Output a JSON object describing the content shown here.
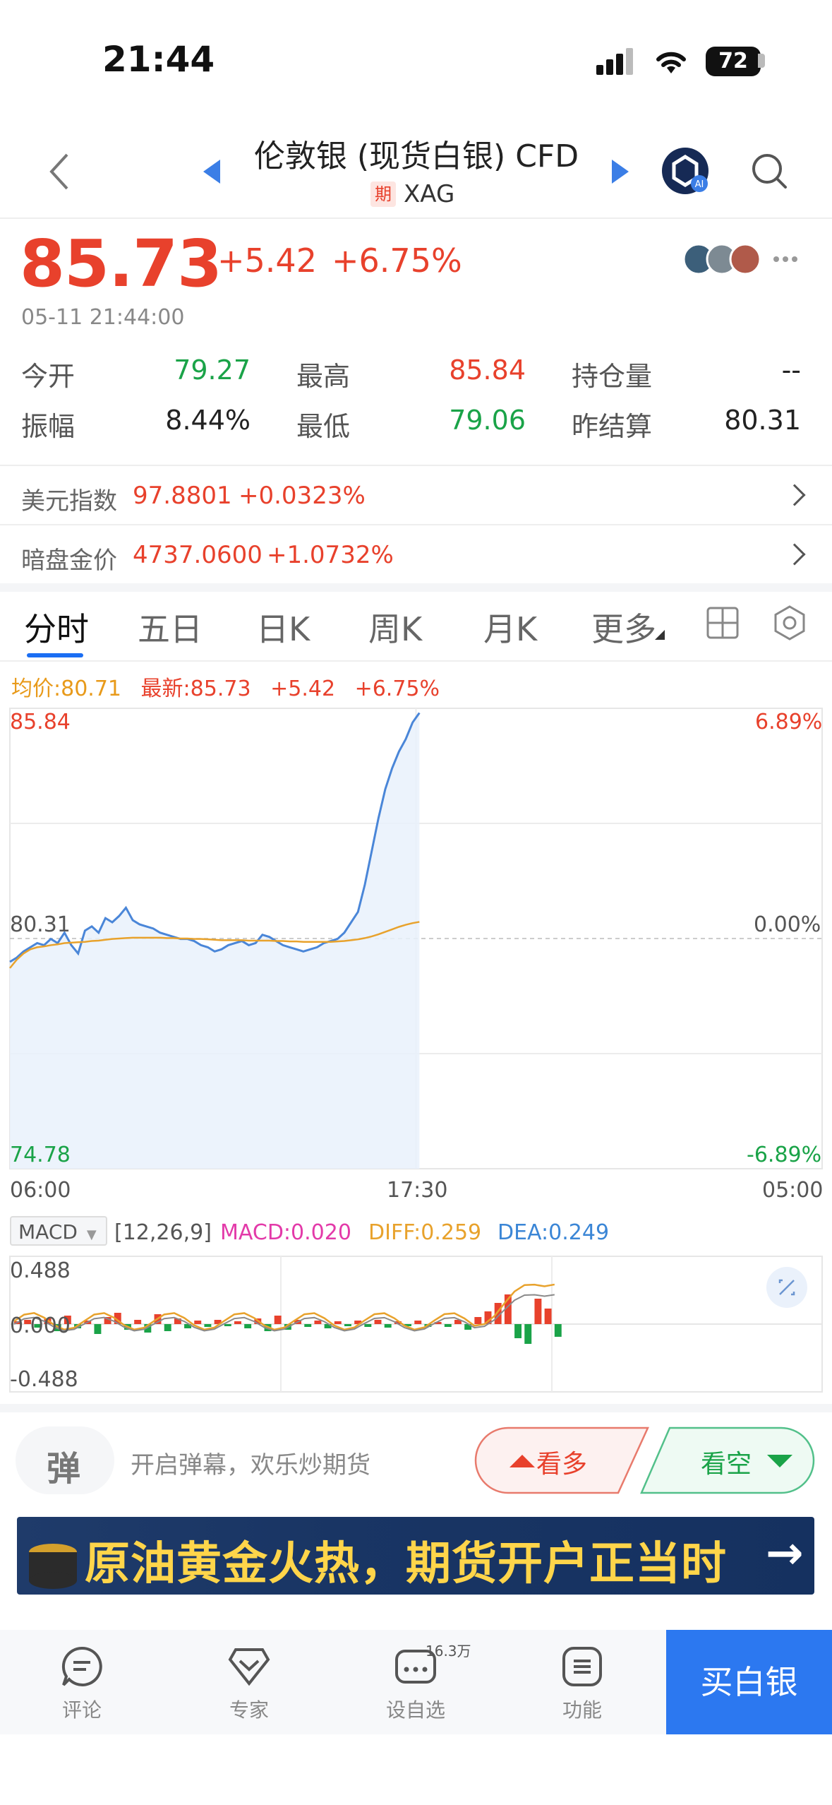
{
  "status_bar": {
    "time": "21:44",
    "battery": "72"
  },
  "nav": {
    "title": "伦敦银 (现货白银) CFD",
    "badge": "期",
    "code": "XAG"
  },
  "quote": {
    "price": "85.73",
    "change": "+5.42",
    "change_pct": "+6.75%",
    "timestamp": "05-11 21:44:00"
  },
  "stats": {
    "open_label": "今开",
    "open_value": "79.27",
    "high_label": "最高",
    "high_value": "85.84",
    "oi_label": "持仓量",
    "oi_value": "--",
    "amp_label": "振幅",
    "amp_value": "8.44%",
    "low_label": "最低",
    "low_value": "79.06",
    "settle_label": "昨结算",
    "settle_value": "80.31"
  },
  "related": [
    {
      "label": "美元指数",
      "value": "97.8801",
      "change": "+0.0323%"
    },
    {
      "label": "暗盘金价",
      "value": "4737.0600",
      "change": "+1.0732%"
    }
  ],
  "tabs": [
    "分时",
    "五日",
    "日K",
    "周K",
    "月K",
    "更多"
  ],
  "chart_header": {
    "avg": "均价:80.71",
    "latest": "最新:85.73",
    "change": "+5.42",
    "pct": "+6.75%"
  },
  "chart_data": {
    "type": "line",
    "left_axis": [
      "85.84",
      "80.31",
      "74.78"
    ],
    "right_axis": [
      "6.89%",
      "0.00%",
      "-6.89%"
    ],
    "x_ticks": [
      "06:00",
      "17:30",
      "05:00"
    ],
    "ylim": [
      74.78,
      85.84
    ],
    "reference": 80.31,
    "series": [
      {
        "name": "",
        "color": "#4a86d8",
        "values": [
          79.75,
          79.85,
          80.0,
          80.1,
          80.2,
          80.15,
          80.3,
          80.2,
          80.45,
          80.15,
          79.95,
          80.5,
          80.6,
          80.45,
          80.8,
          80.7,
          80.85,
          81.05,
          80.75,
          80.65,
          80.6,
          80.55,
          80.45,
          80.4,
          80.35,
          80.3,
          80.3,
          80.25,
          80.15,
          80.1,
          80.0,
          80.05,
          80.15,
          80.2,
          80.25,
          80.15,
          80.2,
          80.4,
          80.35,
          80.25,
          80.15,
          80.1,
          80.05,
          80.0,
          80.05,
          80.1,
          80.2,
          80.25,
          80.3,
          80.45,
          80.7,
          80.95,
          81.6,
          82.4,
          83.2,
          83.9,
          84.4,
          84.8,
          85.1,
          85.5,
          85.73
        ]
      },
      {
        "name": "",
        "color": "#e8a22c",
        "values": [
          79.6,
          79.8,
          79.95,
          80.05,
          80.1,
          80.12,
          80.15,
          80.17,
          80.2,
          80.21,
          80.22,
          80.23,
          80.25,
          80.26,
          80.28,
          80.3,
          80.31,
          80.32,
          80.33,
          80.33,
          80.33,
          80.33,
          80.33,
          80.32,
          80.32,
          80.31,
          80.31,
          80.3,
          80.3,
          80.29,
          80.28,
          80.27,
          80.27,
          80.27,
          80.27,
          80.26,
          80.26,
          80.26,
          80.26,
          80.25,
          80.25,
          80.24,
          80.24,
          80.23,
          80.23,
          80.23,
          80.23,
          80.23,
          80.24,
          80.25,
          80.27,
          80.29,
          80.32,
          80.36,
          80.41,
          80.47,
          80.53,
          80.59,
          80.64,
          80.68,
          80.71
        ]
      }
    ]
  },
  "macd": {
    "label": "MACD",
    "params": "[12,26,9]",
    "macd_value": "MACD:0.020",
    "diff_value": "DIFF:0.259",
    "dea_value": "DEA:0.249",
    "ticks": [
      "0.488",
      "0.000",
      "-0.488"
    ]
  },
  "actions": {
    "danmu_icon": "弹",
    "danmu_text": "开启弹幕，欢乐炒期货",
    "bull": "看多",
    "bear": "看空"
  },
  "banner": {
    "text": "原油黄金火热，期货开户正当时",
    "arrow": "→"
  },
  "bottom_nav": {
    "comment": "评论",
    "expert": "专家",
    "watch": "设自选",
    "watch_count": "16.3万",
    "func": "功能",
    "buy": "买白银"
  },
  "colors": {
    "up": "#e8412c",
    "down": "#1aa348",
    "accent": "#2c78f0"
  }
}
